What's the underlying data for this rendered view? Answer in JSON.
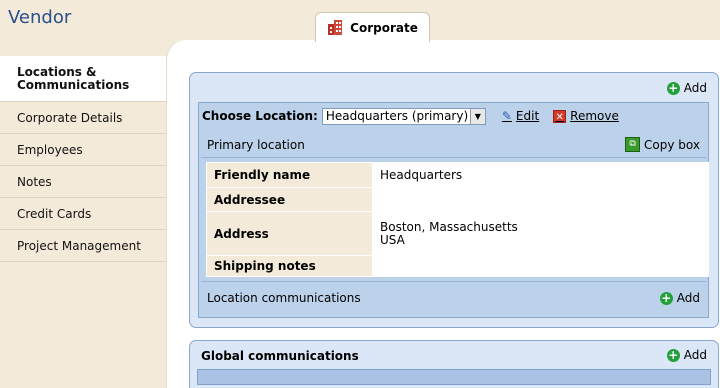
{
  "app": {
    "title": "Vendor"
  },
  "tab": {
    "label": "Corporate",
    "icon": "building-icon"
  },
  "sidebar": {
    "items": [
      {
        "label": "Locations & Communications",
        "active": true
      },
      {
        "label": "Corporate Details"
      },
      {
        "label": "Employees"
      },
      {
        "label": "Notes"
      },
      {
        "label": "Credit Cards"
      },
      {
        "label": "Project Management"
      }
    ]
  },
  "locations": {
    "add_label": "Add",
    "choose_label": "Choose Location:",
    "selected_location": "Headquarters (primary)",
    "edit_label": "Edit",
    "remove_label": "Remove",
    "primary_header": "Primary location",
    "copy_box_label": "Copy box",
    "fields": [
      {
        "label": "Friendly name",
        "value": "Headquarters"
      },
      {
        "label": "Addressee",
        "value": ""
      },
      {
        "label": "Address",
        "value_line1": "Boston, Massachusetts",
        "value_line2": "USA"
      },
      {
        "label": "Shipping notes",
        "value": ""
      }
    ],
    "communications_label": "Location communications",
    "communications_add_label": "Add"
  },
  "global": {
    "title": "Global communications",
    "add_label": "Add"
  },
  "colors": {
    "sidebar_bg": "#f4ead9",
    "panel_bg": "#dbe7f6",
    "panel_border": "#8aa7cc",
    "add_icon": "#22a03a",
    "remove_icon": "#d33a2c",
    "title_text": "#2a4f8a"
  }
}
